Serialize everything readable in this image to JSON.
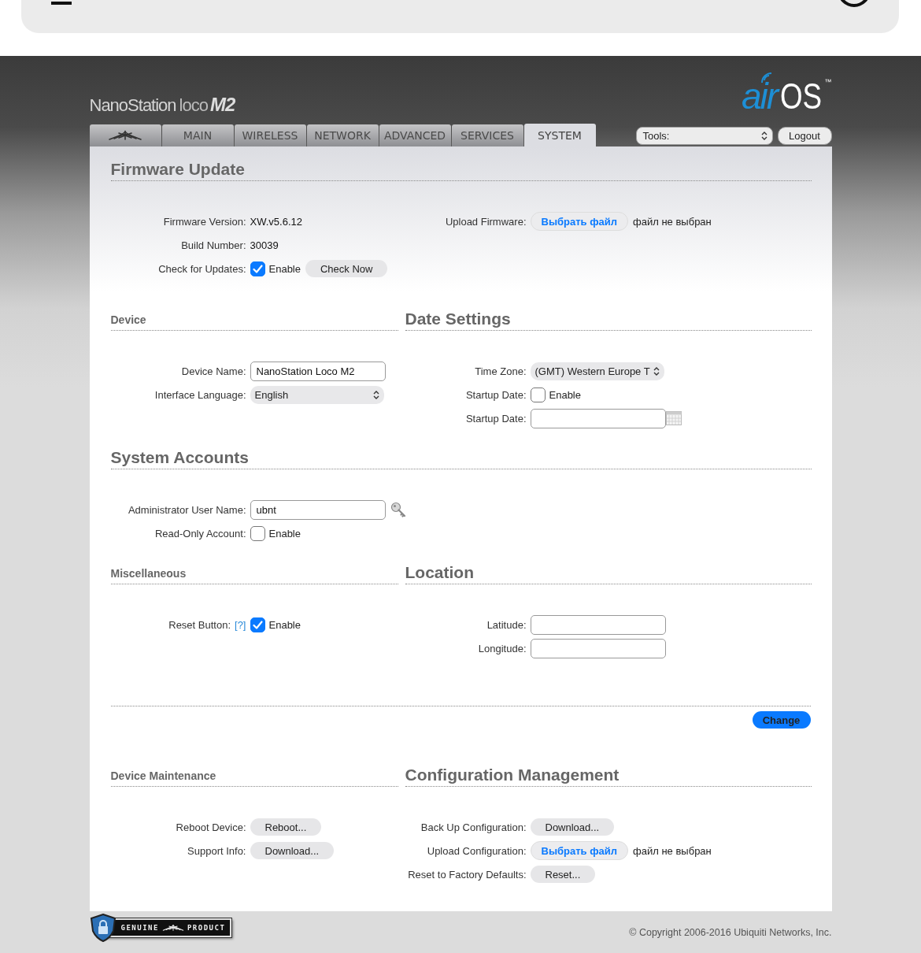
{
  "header": {
    "brand": {
      "name": "NanoStation",
      "model": "loco",
      "variant": "M2"
    },
    "os_logo": {
      "prefix": "air",
      "name": "OS",
      "mark": "™"
    }
  },
  "tabs": [
    {
      "kind": "logo",
      "selected": false
    },
    {
      "kind": "text",
      "label": "MAIN",
      "selected": false
    },
    {
      "kind": "text",
      "label": "WIRELESS",
      "selected": false
    },
    {
      "kind": "text",
      "label": "NETWORK",
      "selected": false
    },
    {
      "kind": "text",
      "label": "ADVANCED",
      "selected": false
    },
    {
      "kind": "text",
      "label": "SERVICES",
      "selected": false
    },
    {
      "kind": "text",
      "label": "SYSTEM",
      "selected": true
    }
  ],
  "tools": {
    "value": "Tools:"
  },
  "logout": "Logout",
  "blocks": [
    {
      "kind": "section",
      "panels": [
        {
          "title": "Firmware Update",
          "kind": "major",
          "columns": [
            [
              {
                "label": "Firmware Version:",
                "controls": [
                  {
                    "kind": "text",
                    "value": "XW.v5.6.12"
                  }
                ]
              },
              {
                "label": "Build Number:",
                "controls": [
                  {
                    "kind": "text",
                    "value": "30039"
                  }
                ]
              },
              {
                "label": "Check for Updates:",
                "controls": [
                  {
                    "kind": "checkbox",
                    "checked": true,
                    "label": "Enable"
                  },
                  {
                    "kind": "button",
                    "label": "Check Now"
                  }
                ]
              }
            ],
            [
              {
                "label": "Upload Firmware:",
                "controls": [
                  {
                    "kind": "file",
                    "label": "Выбрать файл",
                    "status": "файл не выбран"
                  }
                ]
              }
            ]
          ]
        }
      ]
    },
    {
      "kind": "section",
      "panels": [
        {
          "title": "Device",
          "kind": "minor",
          "columns": [
            [
              {
                "label": "Device Name:",
                "controls": [
                  {
                    "kind": "input",
                    "value": "NanoStation Loco M2"
                  }
                ]
              },
              {
                "label": "Interface Language:",
                "controls": [
                  {
                    "kind": "select",
                    "value": "English"
                  }
                ]
              }
            ]
          ]
        },
        {
          "title": "Date Settings",
          "kind": "major",
          "columns": [
            [
              {
                "label": "Time Zone:",
                "controls": [
                  {
                    "kind": "select",
                    "value": "(GMT) Western Europe T"
                  }
                ]
              },
              {
                "label": "Startup Date:",
                "controls": [
                  {
                    "kind": "checkbox",
                    "checked": false,
                    "label": "Enable"
                  }
                ]
              },
              {
                "label": "Startup Date:",
                "controls": [
                  {
                    "kind": "input"
                  },
                  {
                    "kind": "calendar"
                  }
                ]
              }
            ]
          ]
        }
      ]
    },
    {
      "kind": "section",
      "panels": [
        {
          "title": "System Accounts",
          "kind": "major",
          "columns": [
            [
              {
                "label": "Administrator User Name:",
                "controls": [
                  {
                    "kind": "input",
                    "value": "ubnt"
                  },
                  {
                    "kind": "key"
                  }
                ]
              },
              {
                "label": "Read-Only Account:",
                "controls": [
                  {
                    "kind": "checkbox",
                    "checked": false,
                    "label": "Enable"
                  }
                ]
              }
            ]
          ]
        }
      ]
    },
    {
      "kind": "section",
      "panels": [
        {
          "title": "Miscellaneous",
          "kind": "minor",
          "columns": [
            [
              {
                "label": "Reset Button:",
                "help": "[?]",
                "controls": [
                  {
                    "kind": "checkbox",
                    "checked": true,
                    "label": "Enable"
                  }
                ]
              }
            ]
          ]
        },
        {
          "title": "Location",
          "kind": "major",
          "columns": [
            [
              {
                "label": "Latitude:",
                "controls": [
                  {
                    "kind": "input"
                  }
                ]
              },
              {
                "label": "Longitude:",
                "controls": [
                  {
                    "kind": "input"
                  }
                ]
              }
            ]
          ]
        }
      ]
    },
    {
      "kind": "actions",
      "button": "Change"
    },
    {
      "kind": "section",
      "panels": [
        {
          "title": "Device Maintenance",
          "kind": "minor",
          "columns": [
            [
              {
                "label": "Reboot Device:",
                "controls": [
                  {
                    "kind": "button",
                    "label": "Reboot..."
                  }
                ]
              },
              {
                "label": "Support Info:",
                "controls": [
                  {
                    "kind": "button",
                    "label": "Download..."
                  }
                ]
              }
            ]
          ]
        },
        {
          "title": "Configuration Management",
          "kind": "major",
          "columns": [
            [
              {
                "label": "Back Up Configuration:",
                "controls": [
                  {
                    "kind": "button",
                    "label": "Download..."
                  }
                ]
              },
              {
                "label": "Upload Configuration:",
                "controls": [
                  {
                    "kind": "file",
                    "label": "Выбрать файл",
                    "status": "файл не выбран"
                  }
                ]
              },
              {
                "label": "Reset to Factory Defaults:",
                "controls": [
                  {
                    "kind": "button",
                    "label": "Reset..."
                  }
                ]
              }
            ]
          ]
        }
      ]
    }
  ],
  "footer": {
    "badge": {
      "left": "GENUINE",
      "right": "PRODUCT"
    },
    "copyright": "© Copyright 2006-2016 Ubiquiti Networks, Inc."
  }
}
